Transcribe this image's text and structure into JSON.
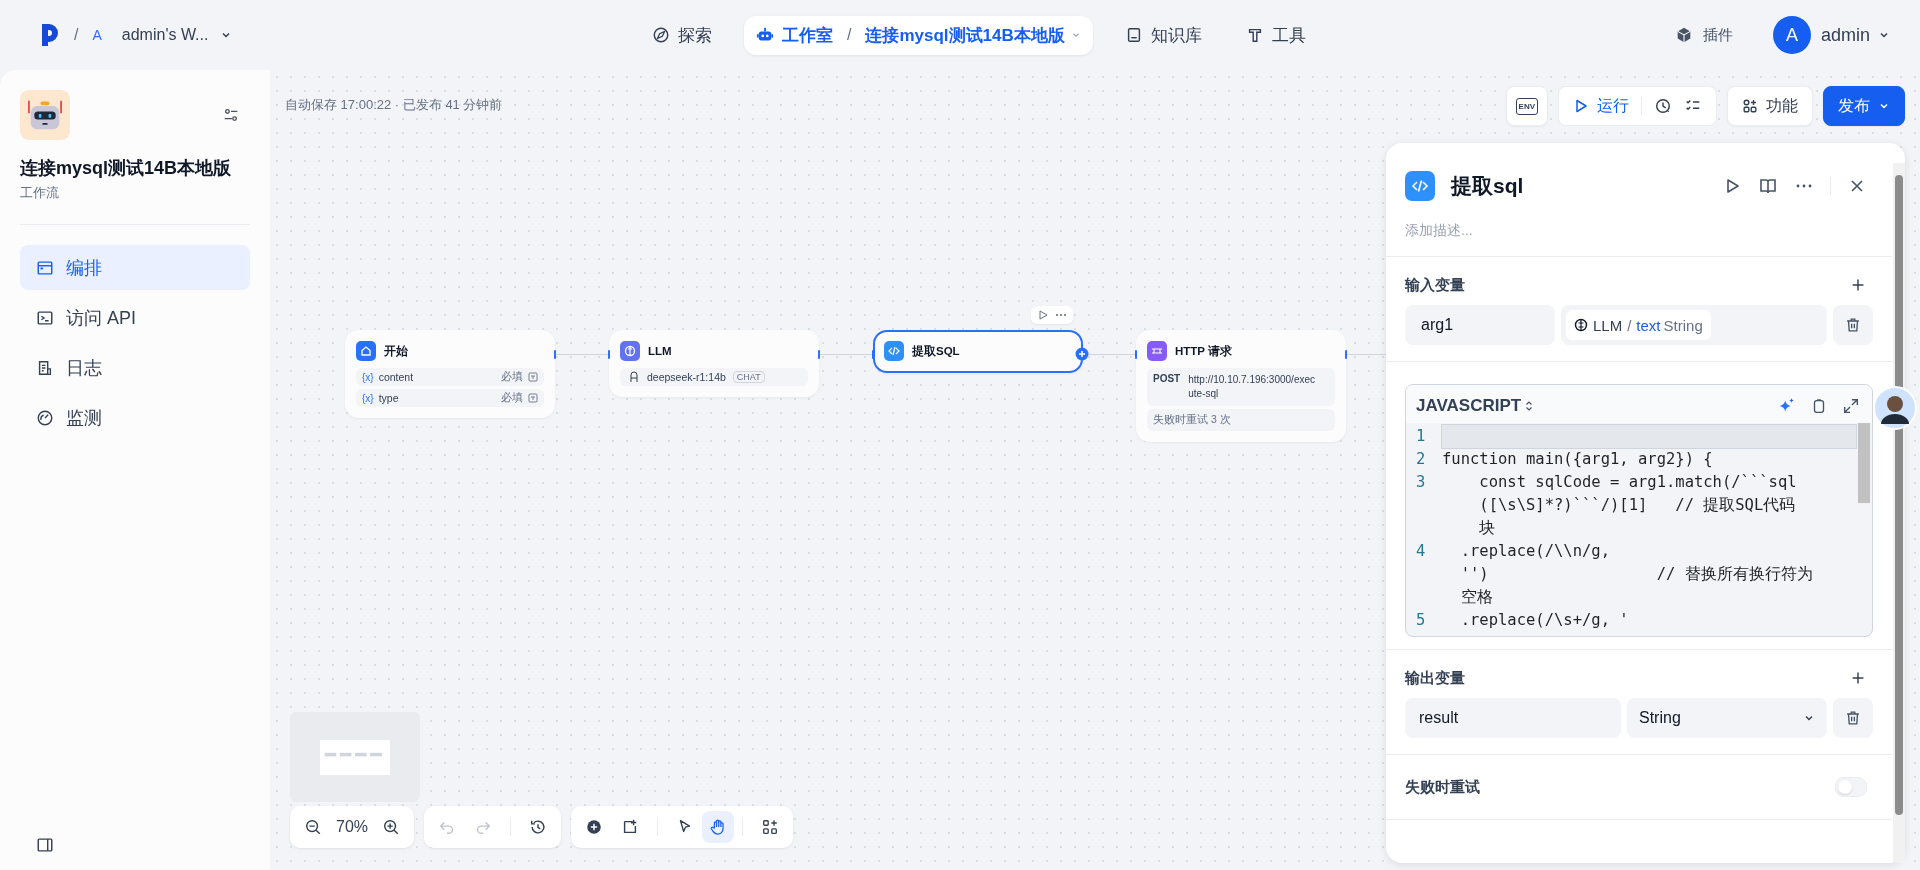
{
  "topbar": {
    "separator": "/",
    "workspace": {
      "initial": "A",
      "name": "admin's W..."
    },
    "nav": [
      {
        "kind": "explore",
        "label": "探索",
        "selected": false
      },
      {
        "kind": "studio",
        "label": "工作室",
        "separator": "/",
        "app": "连接mysql测试14B本地版",
        "selected": true
      },
      {
        "kind": "knowledge",
        "label": "知识库",
        "selected": false
      },
      {
        "kind": "tools",
        "label": "工具",
        "selected": false
      }
    ],
    "plugins": "插件",
    "user": {
      "initial": "A",
      "name": "admin"
    }
  },
  "sidebar": {
    "app_name": "连接mysql测试14B本地版",
    "app_type": "工作流",
    "items": [
      {
        "kind": "orchestrate",
        "label": "编排",
        "selected": true
      },
      {
        "kind": "api",
        "label": "访问 API",
        "selected": false
      },
      {
        "kind": "logs",
        "label": "日志",
        "selected": false
      },
      {
        "kind": "monitor",
        "label": "监测",
        "selected": false
      }
    ]
  },
  "canvas": {
    "status": "自动保存 17:00:22 · 已发布 41 分钟前",
    "toolbar": {
      "env": "ENV",
      "run": "运行",
      "features": "功能",
      "publish": "发布"
    },
    "nodes": [
      {
        "kind": "start",
        "title": "开始",
        "color": "#2970ff",
        "selected": false,
        "variables": [
          {
            "icon": "{x}",
            "name": "content",
            "required": "必填"
          },
          {
            "icon": "{x}",
            "name": "type",
            "required": "必填"
          }
        ]
      },
      {
        "kind": "llm",
        "title": "LLM",
        "color": "#6172f3",
        "selected": false,
        "model": "deepseek-r1:14b",
        "mode": "CHAT"
      },
      {
        "kind": "code",
        "title": "提取SQL",
        "color": "#2e90fa",
        "selected": true
      },
      {
        "kind": "http",
        "title": "HTTP 请求",
        "color": "#875bf7",
        "selected": false,
        "method": "POST",
        "url": "http://10.10.7.196:3000/execute-sql",
        "retry": "失败时重试 3 次"
      }
    ],
    "zoom": "70%"
  },
  "panel": {
    "title": "提取sql",
    "description_placeholder": "添加描述...",
    "inputs": {
      "title": "输入变量",
      "items": [
        {
          "name": "arg1",
          "source": "LLM",
          "separator": "/",
          "variable": "text",
          "type": "String"
        }
      ]
    },
    "code": {
      "language": "JAVASCRIPT",
      "lines": [
        {
          "number": "1",
          "active": true
        },
        {
          "number": "2",
          "active": false,
          "rows": [
            "function main({arg1, arg2}) {"
          ]
        },
        {
          "number": "3",
          "active": false,
          "rows": [
            "    const sqlCode = arg1.match(/```sql",
            "    ([\\s\\S]*?)```/)[1]   // 提取SQL代码",
            "    块"
          ]
        },
        {
          "number": "4",
          "active": false,
          "rows": [
            "  .replace(/\\\\n/g,",
            "  '')                  // 替换所有换行符为",
            "  空格"
          ]
        },
        {
          "number": "5",
          "active": false,
          "rows": [
            "  .replace(/\\s+/g, '"
          ]
        }
      ]
    },
    "outputs": {
      "title": "输出变量",
      "items": [
        {
          "name": "result",
          "type": "String"
        }
      ]
    },
    "retry": {
      "label": "失败时重试",
      "on": false
    }
  }
}
